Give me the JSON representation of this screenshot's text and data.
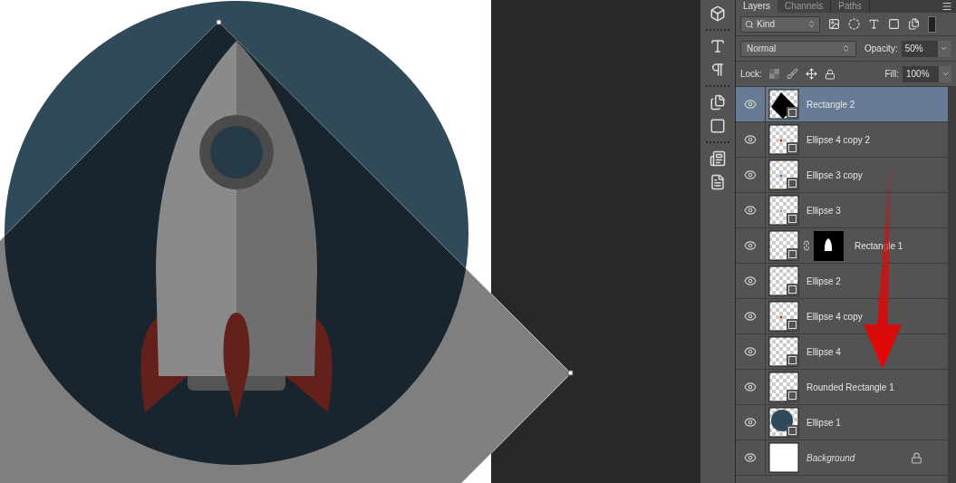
{
  "tabs": [
    {
      "label": "Layers",
      "selected": true
    },
    {
      "label": "Channels",
      "selected": false
    },
    {
      "label": "Paths",
      "selected": false
    }
  ],
  "filter": {
    "value": "Kind"
  },
  "blend": {
    "mode": "Normal",
    "opacity_label": "Opacity:",
    "opacity": "50%"
  },
  "lock": {
    "label": "Lock:",
    "fill_label": "Fill:",
    "fill": "100%"
  },
  "layers": [
    {
      "name": "Rectangle 2",
      "selected": true,
      "visible": true,
      "kind": "shape",
      "thumbnail": {
        "kind": "diamond"
      }
    },
    {
      "name": "Ellipse 4 copy 2",
      "selected": false,
      "visible": true,
      "kind": "shape",
      "thumbnail": {
        "kind": "reddot"
      }
    },
    {
      "name": "Ellipse 3 copy",
      "selected": false,
      "visible": true,
      "kind": "shape",
      "thumbnail": {
        "kind": "bluedot"
      }
    },
    {
      "name": "Ellipse 3",
      "selected": false,
      "visible": true,
      "kind": "shape",
      "thumbnail": {
        "kind": "graydot"
      }
    },
    {
      "name": "Rectangle 1",
      "selected": false,
      "visible": true,
      "kind": "masked",
      "thumbnail": {
        "kind": "checker"
      }
    },
    {
      "name": "Ellipse 2",
      "selected": false,
      "visible": true,
      "kind": "shape",
      "thumbnail": {
        "kind": "checker"
      }
    },
    {
      "name": "Ellipse 4 copy",
      "selected": false,
      "visible": true,
      "kind": "shape",
      "thumbnail": {
        "kind": "reddot"
      }
    },
    {
      "name": "Ellipse 4",
      "selected": false,
      "visible": true,
      "kind": "shape",
      "thumbnail": {
        "kind": "checker"
      }
    },
    {
      "name": "Rounded Rectangle 1",
      "selected": false,
      "visible": true,
      "kind": "shape",
      "thumbnail": {
        "kind": "checker"
      }
    },
    {
      "name": "Ellipse 1",
      "selected": false,
      "visible": true,
      "kind": "shape",
      "thumbnail": {
        "kind": "circle"
      }
    },
    {
      "name": "Background",
      "selected": false,
      "visible": true,
      "kind": "background",
      "thumbnail": {
        "kind": "white"
      }
    }
  ]
}
